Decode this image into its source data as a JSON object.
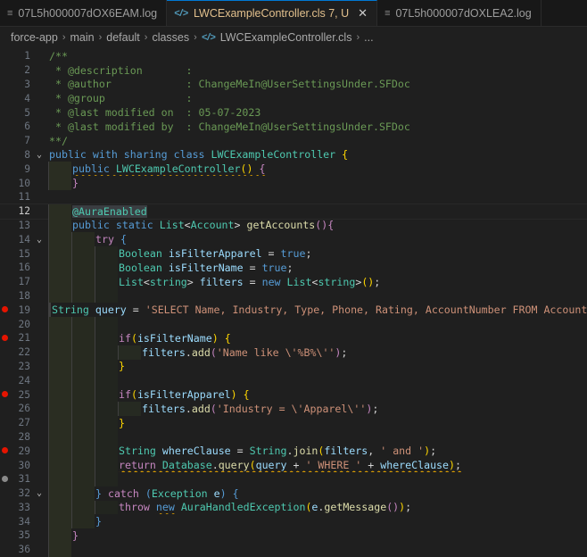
{
  "tabs": [
    {
      "label": "07L5h000007dOX6EAM.log",
      "icon": "file-icon",
      "active": false
    },
    {
      "label": "LWCExampleController.cls 7, U",
      "icon": "apex-icon",
      "active": true
    },
    {
      "label": "07L5h000007dOXLEA2.log",
      "icon": "file-icon",
      "active": false
    }
  ],
  "breadcrumb": [
    "force-app",
    "main",
    "default",
    "classes",
    "LWCExampleController.cls",
    "..."
  ],
  "current_line": 12,
  "lines": [
    {
      "n": 1,
      "indent": 0,
      "tokens": [
        [
          "c",
          "/**"
        ]
      ]
    },
    {
      "n": 2,
      "indent": 0,
      "tokens": [
        [
          "c",
          " * @description       :"
        ]
      ]
    },
    {
      "n": 3,
      "indent": 0,
      "tokens": [
        [
          "c",
          " * @author            : ChangeMeIn@UserSettingsUnder.SFDoc"
        ]
      ]
    },
    {
      "n": 4,
      "indent": 0,
      "tokens": [
        [
          "c",
          " * @group             :"
        ]
      ]
    },
    {
      "n": 5,
      "indent": 0,
      "tokens": [
        [
          "c",
          " * @last modified on  : 05-07-2023"
        ]
      ]
    },
    {
      "n": 6,
      "indent": 0,
      "tokens": [
        [
          "c",
          " * @last modified by  : ChangeMeIn@UserSettingsUnder.SFDoc"
        ]
      ]
    },
    {
      "n": 7,
      "indent": 0,
      "tokens": [
        [
          "c",
          "**/"
        ]
      ]
    },
    {
      "n": 8,
      "indent": 0,
      "fold": true,
      "tokens": [
        [
          "k",
          "public"
        ],
        [
          "p",
          " "
        ],
        [
          "k",
          "with"
        ],
        [
          "p",
          " "
        ],
        [
          "k",
          "sharing"
        ],
        [
          "p",
          " "
        ],
        [
          "k",
          "class"
        ],
        [
          "p",
          " "
        ],
        [
          "t",
          "LWCExampleController"
        ],
        [
          "p",
          " "
        ],
        [
          "b",
          "{"
        ]
      ]
    },
    {
      "n": 9,
      "indent": 1,
      "tokens": [
        [
          "k squig",
          "public"
        ],
        [
          "p squig",
          " "
        ],
        [
          "t squig",
          "LWCExampleController"
        ],
        [
          "b squig",
          "()"
        ],
        [
          "p squig",
          " "
        ],
        [
          "ctl squig",
          "{"
        ]
      ]
    },
    {
      "n": 10,
      "indent": 1,
      "tokens": [
        [
          "ctl",
          "}"
        ]
      ]
    },
    {
      "n": 11,
      "indent": 0,
      "tokens": []
    },
    {
      "n": 12,
      "indent": 1,
      "tokens": [
        [
          "t ann",
          "@AuraEnabled"
        ]
      ]
    },
    {
      "n": 13,
      "indent": 1,
      "tokens": [
        [
          "k",
          "public"
        ],
        [
          "p",
          " "
        ],
        [
          "k",
          "static"
        ],
        [
          "p",
          " "
        ],
        [
          "t",
          "List"
        ],
        [
          "p",
          "<"
        ],
        [
          "t",
          "Account"
        ],
        [
          "p",
          "> "
        ],
        [
          "f",
          "getAccounts"
        ],
        [
          "ctl",
          "()"
        ],
        [
          "ctl",
          "{"
        ]
      ]
    },
    {
      "n": 14,
      "indent": 2,
      "fold": true,
      "tokens": [
        [
          "ctl",
          "try"
        ],
        [
          "p",
          " "
        ],
        [
          "k",
          "{"
        ]
      ]
    },
    {
      "n": 15,
      "indent": 3,
      "tokens": [
        [
          "t",
          "Boolean"
        ],
        [
          "p",
          " "
        ],
        [
          "v",
          "isFilterApparel"
        ],
        [
          "p",
          " = "
        ],
        [
          "k",
          "true"
        ],
        [
          "p",
          ";"
        ]
      ]
    },
    {
      "n": 16,
      "indent": 3,
      "tokens": [
        [
          "t",
          "Boolean"
        ],
        [
          "p",
          " "
        ],
        [
          "v",
          "isFilterName"
        ],
        [
          "p",
          " = "
        ],
        [
          "k",
          "true"
        ],
        [
          "p",
          ";"
        ]
      ]
    },
    {
      "n": 17,
      "indent": 3,
      "tokens": [
        [
          "t",
          "List"
        ],
        [
          "p",
          "<"
        ],
        [
          "t",
          "string"
        ],
        [
          "p",
          "> "
        ],
        [
          "v",
          "filters"
        ],
        [
          "p",
          " = "
        ],
        [
          "k",
          "new"
        ],
        [
          "p",
          " "
        ],
        [
          "t",
          "List"
        ],
        [
          "p",
          "<"
        ],
        [
          "t",
          "string"
        ],
        [
          "p",
          ">"
        ],
        [
          "b",
          "()"
        ],
        [
          "p",
          ";"
        ]
      ]
    },
    {
      "n": 18,
      "indent": 3,
      "tokens": []
    },
    {
      "n": 19,
      "indent": 3,
      "bp": "red",
      "tokens": [
        [
          "t",
          "String"
        ],
        [
          "p",
          " "
        ],
        [
          "v",
          "query"
        ],
        [
          "p",
          " = "
        ],
        [
          "s",
          "'SELECT Name, Industry, Type, Phone, Rating, AccountNumber FROM Account'"
        ]
      ]
    },
    {
      "n": 20,
      "indent": 3,
      "tokens": []
    },
    {
      "n": 21,
      "indent": 3,
      "bp": "red",
      "tokens": [
        [
          "ctl",
          "if"
        ],
        [
          "b",
          "("
        ],
        [
          "v",
          "isFilterName"
        ],
        [
          "b",
          ")"
        ],
        [
          "p",
          " "
        ],
        [
          "b",
          "{"
        ]
      ]
    },
    {
      "n": 22,
      "indent": 4,
      "tokens": [
        [
          "v",
          "filters"
        ],
        [
          "p",
          "."
        ],
        [
          "f",
          "add"
        ],
        [
          "ctl",
          "("
        ],
        [
          "s",
          "'Name like \\'%B%\\''"
        ],
        [
          "ctl",
          ")"
        ],
        [
          "p",
          ";"
        ]
      ]
    },
    {
      "n": 23,
      "indent": 3,
      "tokens": [
        [
          "b",
          "}"
        ]
      ]
    },
    {
      "n": 24,
      "indent": 3,
      "tokens": []
    },
    {
      "n": 25,
      "indent": 3,
      "bp": "red",
      "tokens": [
        [
          "ctl",
          "if"
        ],
        [
          "b",
          "("
        ],
        [
          "v",
          "isFilterApparel"
        ],
        [
          "b",
          ")"
        ],
        [
          "p",
          " "
        ],
        [
          "b",
          "{"
        ]
      ]
    },
    {
      "n": 26,
      "indent": 4,
      "tokens": [
        [
          "v",
          "filters"
        ],
        [
          "p",
          "."
        ],
        [
          "f",
          "add"
        ],
        [
          "ctl",
          "("
        ],
        [
          "s",
          "'Industry = \\'Apparel\\''"
        ],
        [
          "ctl",
          ")"
        ],
        [
          "p",
          ";"
        ]
      ]
    },
    {
      "n": 27,
      "indent": 3,
      "tokens": [
        [
          "b",
          "}"
        ]
      ]
    },
    {
      "n": 28,
      "indent": 3,
      "tokens": []
    },
    {
      "n": 29,
      "indent": 3,
      "bp": "red",
      "tokens": [
        [
          "t",
          "String"
        ],
        [
          "p",
          " "
        ],
        [
          "v",
          "whereClause"
        ],
        [
          "p",
          " = "
        ],
        [
          "t",
          "String"
        ],
        [
          "p",
          "."
        ],
        [
          "f",
          "join"
        ],
        [
          "b",
          "("
        ],
        [
          "v",
          "filters"
        ],
        [
          "p",
          ", "
        ],
        [
          "s",
          "' and '"
        ],
        [
          "b",
          ")"
        ],
        [
          "p",
          ";"
        ]
      ]
    },
    {
      "n": 30,
      "indent": 3,
      "tokens": [
        [
          "ctl squig",
          "return"
        ],
        [
          "p squig",
          " "
        ],
        [
          "t squig",
          "Database"
        ],
        [
          "p squig",
          "."
        ],
        [
          "f squig",
          "query"
        ],
        [
          "b squig",
          "("
        ],
        [
          "v squig",
          "query"
        ],
        [
          "p squig",
          " + "
        ],
        [
          "s squig",
          "' WHERE '"
        ],
        [
          "p squig",
          " + "
        ],
        [
          "v squig",
          "whereClause"
        ],
        [
          "b squig",
          ")"
        ],
        [
          "p squig",
          ";"
        ]
      ]
    },
    {
      "n": 31,
      "indent": 3,
      "bp": "grey",
      "tokens": []
    },
    {
      "n": 32,
      "indent": 2,
      "fold": true,
      "tokens": [
        [
          "k",
          "}"
        ],
        [
          "p",
          " "
        ],
        [
          "ctl",
          "catch"
        ],
        [
          "p",
          " "
        ],
        [
          "k",
          "("
        ],
        [
          "t",
          "Exception"
        ],
        [
          "p",
          " "
        ],
        [
          "v",
          "e"
        ],
        [
          "k",
          ")"
        ],
        [
          "p",
          " "
        ],
        [
          "k",
          "{"
        ]
      ]
    },
    {
      "n": 33,
      "indent": 3,
      "tokens": [
        [
          "ctl",
          "throw"
        ],
        [
          "p",
          " "
        ],
        [
          "k squig",
          "new"
        ],
        [
          "p",
          " "
        ],
        [
          "t",
          "AuraHandledException"
        ],
        [
          "b",
          "("
        ],
        [
          "v",
          "e"
        ],
        [
          "p",
          "."
        ],
        [
          "f",
          "getMessage"
        ],
        [
          "ctl",
          "()"
        ],
        [
          "b",
          ")"
        ],
        [
          "p",
          ";"
        ]
      ]
    },
    {
      "n": 34,
      "indent": 2,
      "tokens": [
        [
          "k",
          "}"
        ]
      ]
    },
    {
      "n": 35,
      "indent": 1,
      "tokens": [
        [
          "ctl",
          "}"
        ]
      ]
    },
    {
      "n": 36,
      "indent": 1,
      "tokens": []
    }
  ]
}
